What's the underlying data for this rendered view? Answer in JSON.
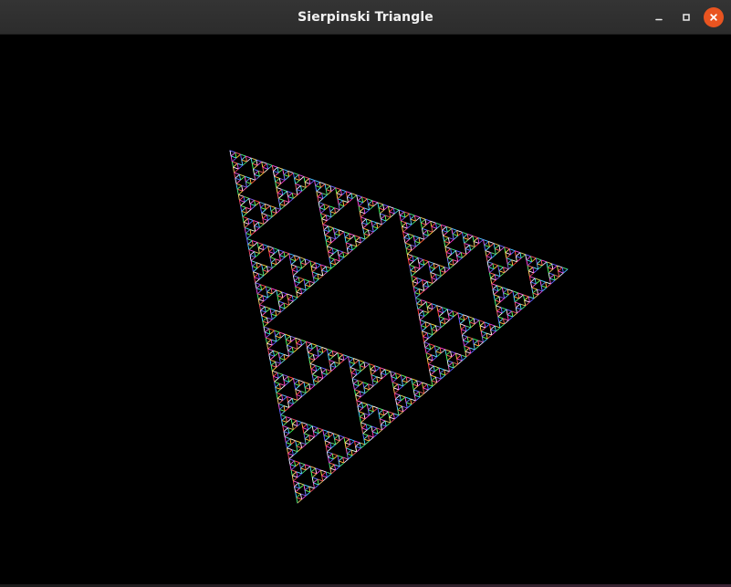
{
  "window": {
    "title": "Sierpinski Triangle",
    "controls": {
      "minimize_icon": "minimize-icon",
      "maximize_icon": "maximize-icon",
      "close_icon": "close-icon"
    },
    "colors": {
      "titlebar": "#2c2c2c",
      "title_text": "#f2f2f2",
      "close_button": "#e95420",
      "canvas_background": "#000000"
    }
  },
  "drawing": {
    "shape": "sierpinski-triangle",
    "palette": [
      "#ff3b3b",
      "#ffd23b",
      "#3bff5a",
      "#3bd7ff",
      "#5a5aff",
      "#ff3bd2",
      "#ffffff"
    ]
  }
}
